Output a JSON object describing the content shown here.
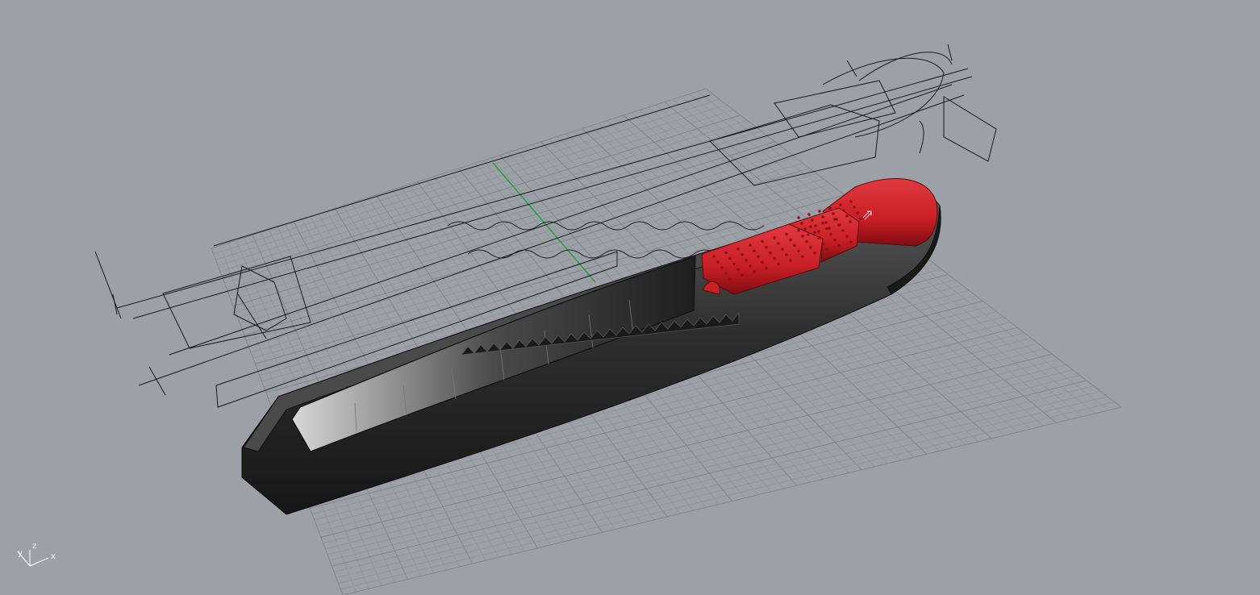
{
  "viewport": {
    "background_color": "#9ba1a7",
    "grid_color": "#8a9096",
    "grid_major_color": "#7e848a",
    "y_axis_color": "#1e9e3a",
    "x_axis_color": "#b24a4a",
    "wireframe_color": "#1b1b1b"
  },
  "model": {
    "body_color": "#2a2a2a",
    "body_highlight_color": "#6a6a6a",
    "slider_color": "#c91f26",
    "slider_shadow_color": "#8e0f14",
    "slider_glyph": "⇗"
  },
  "axis_widget": {
    "x_label": "x",
    "y_label": "y",
    "z_label": "z"
  }
}
